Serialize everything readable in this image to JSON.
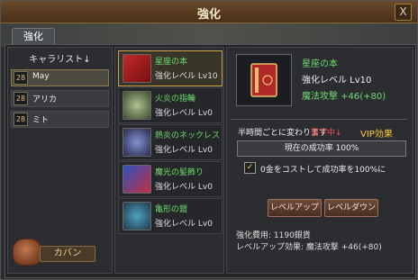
{
  "window": {
    "title": "強化",
    "close": "X"
  },
  "tab": {
    "label": "強化"
  },
  "characters": {
    "header": "キャラリスト↓",
    "items": [
      {
        "level": "28",
        "name": "May"
      },
      {
        "level": "28",
        "name": "アリカ"
      },
      {
        "level": "28",
        "name": "ミト"
      }
    ]
  },
  "bag": {
    "label": "カバン"
  },
  "equipment": [
    {
      "name": "星座の本",
      "level": "強化レベル  Lv10",
      "icon": "book-icon"
    },
    {
      "name": "火炎の指輪",
      "level": "強化レベル  Lv0",
      "icon": "ring-icon"
    },
    {
      "name": "熱炎のネックレス",
      "level": "強化レベル  Lv0",
      "icon": "necklace-icon"
    },
    {
      "name": "魔光の髪飾り",
      "level": "強化レベル  Lv0",
      "icon": "hair-ornament-icon"
    },
    {
      "name": "亀形の鎧",
      "level": "強化レベル  Lv0",
      "icon": "armor-icon"
    }
  ],
  "detail": {
    "name": "星座の本",
    "level": "強化レベル Lv10",
    "stat": "魔法攻撃  +46(+80)",
    "rate_label": "半時間ごとに変わります",
    "rate_state": "落下中↓",
    "vip": "VIP効果",
    "rate_bar": "現在の成功率  100%",
    "checkbox_label": "0金をコストして成功率を100%に",
    "button_up": "レベルアップ",
    "button_down": "レベルダウン",
    "cost": "強化費用: 1190銀貨",
    "effect": "レベルアップ効果: 魔法攻撃 +46(+80)"
  },
  "colors": {
    "selection": "#c9a350",
    "item_name": "#6fdc6f",
    "warning": "#ff5050",
    "vip": "#ffd040"
  }
}
